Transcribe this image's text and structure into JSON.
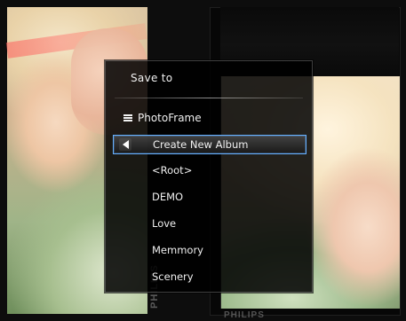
{
  "menu": {
    "title": "Save to",
    "header": {
      "label": "PhotoFrame",
      "icon": "list-icon"
    },
    "items": [
      {
        "label": "Create New Album",
        "selected": true,
        "icon": "back-arrow-icon"
      },
      {
        "label": "<Root>"
      },
      {
        "label": "DEMO"
      },
      {
        "label": "Love"
      },
      {
        "label": "Memmory"
      },
      {
        "label": "Scenery"
      }
    ]
  },
  "device": {
    "brand_vertical": "PHILIPS",
    "brand_bottom": "PHILIPS"
  },
  "colors": {
    "selection_border": "#66b0ff",
    "menu_background": "#000000",
    "text": "#f0f0f0"
  }
}
